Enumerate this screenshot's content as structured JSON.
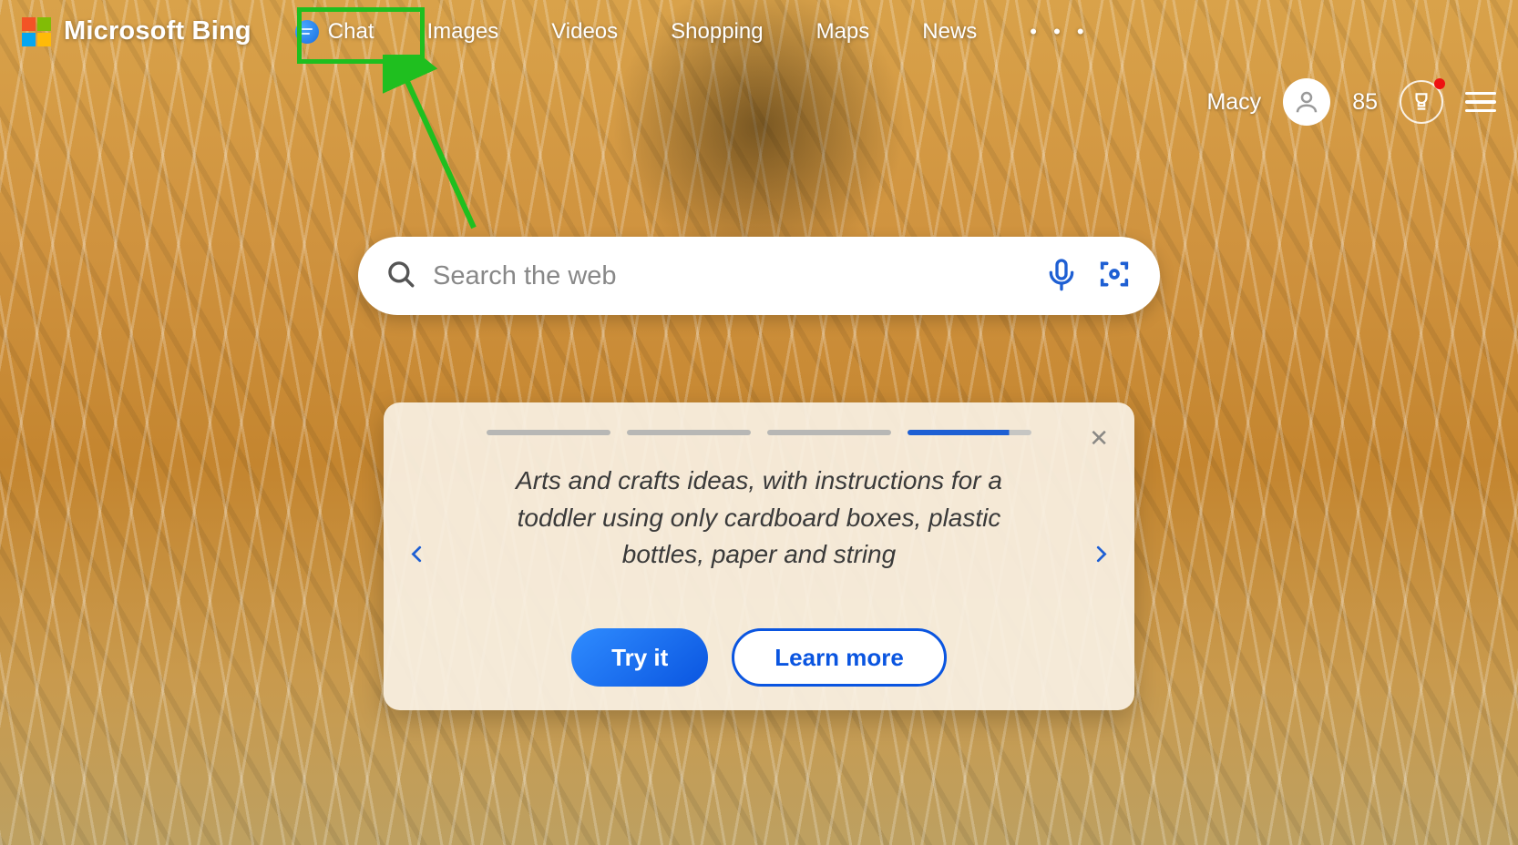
{
  "brand": {
    "text": "Microsoft Bing"
  },
  "nav": {
    "chat": "Chat",
    "images": "Images",
    "videos": "Videos",
    "shopping": "Shopping",
    "maps": "Maps",
    "news": "News",
    "more": "• • •"
  },
  "user": {
    "name": "Macy",
    "points": "85"
  },
  "search": {
    "placeholder": "Search the web"
  },
  "card": {
    "prompt": "Arts and crafts ideas, with instructions for a toddler using only cardboard boxes, plastic bottles, paper and string",
    "try": "Try it",
    "learn": "Learn more"
  }
}
